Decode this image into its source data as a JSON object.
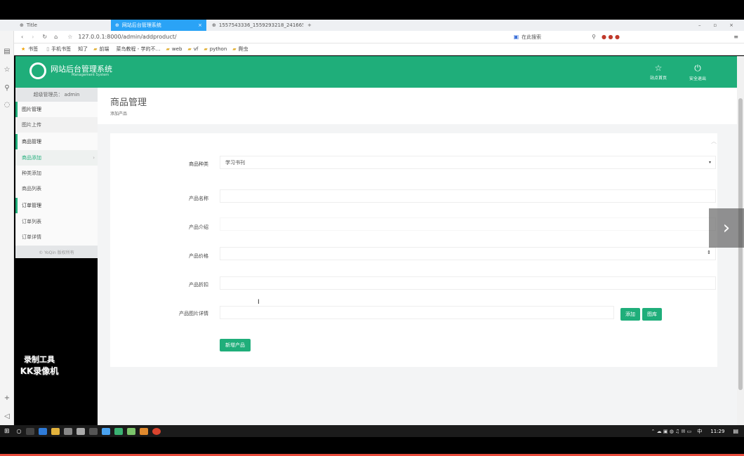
{
  "browser": {
    "tabs": [
      {
        "label": "Title",
        "active": false
      },
      {
        "label": "网站后台管理系统",
        "active": true
      },
      {
        "label": "1557543336_1559293218_241665…",
        "active": false
      }
    ],
    "address": "127.0.0.1:8000/admin/addproduct/",
    "search_label": "在此搜索",
    "bookmarks": [
      "书签",
      "手机书签",
      "知了",
      "前端",
      "菜鸟教程 - 学的不…",
      "web",
      "vf",
      "python",
      "爬虫"
    ]
  },
  "header": {
    "title": "网站后台管理系统",
    "subtitle": "Management System",
    "home_label": "站点首页",
    "logout_label": "安全退出"
  },
  "sidebar": {
    "user_prefix": "超级管理员：",
    "user_name": "admin",
    "items": [
      {
        "label": "图片管理",
        "type": "head"
      },
      {
        "label": "图片上传",
        "type": "item"
      },
      {
        "label": "商品管理",
        "type": "head"
      },
      {
        "label": "商品添加",
        "type": "item-active"
      },
      {
        "label": "种类添加",
        "type": "item"
      },
      {
        "label": "商品列表",
        "type": "item"
      },
      {
        "label": "订单管理",
        "type": "head"
      },
      {
        "label": "订单列表",
        "type": "item"
      },
      {
        "label": "订单详情",
        "type": "item"
      }
    ],
    "footer": "© YoQin 版权所有"
  },
  "page": {
    "title": "商品管理",
    "breadcrumb": "添加产品"
  },
  "form": {
    "category_label": "商品种类",
    "category_value": "学习书刊",
    "name_label": "产品名称",
    "intro_label": "产品介绍",
    "price_label": "产品价格",
    "discount_label": "产品折扣",
    "image_label": "产品图片详情",
    "add_btn": "添加",
    "image_btn": "图库",
    "submit_btn": "新增产品"
  },
  "watermark": {
    "line1": "录制工具",
    "line2": "KK录像机"
  },
  "taskbar": {
    "time": "11:29",
    "ime": "中"
  },
  "colors": {
    "accent": "#1fae7a",
    "tab_active": "#2aa3f6"
  }
}
